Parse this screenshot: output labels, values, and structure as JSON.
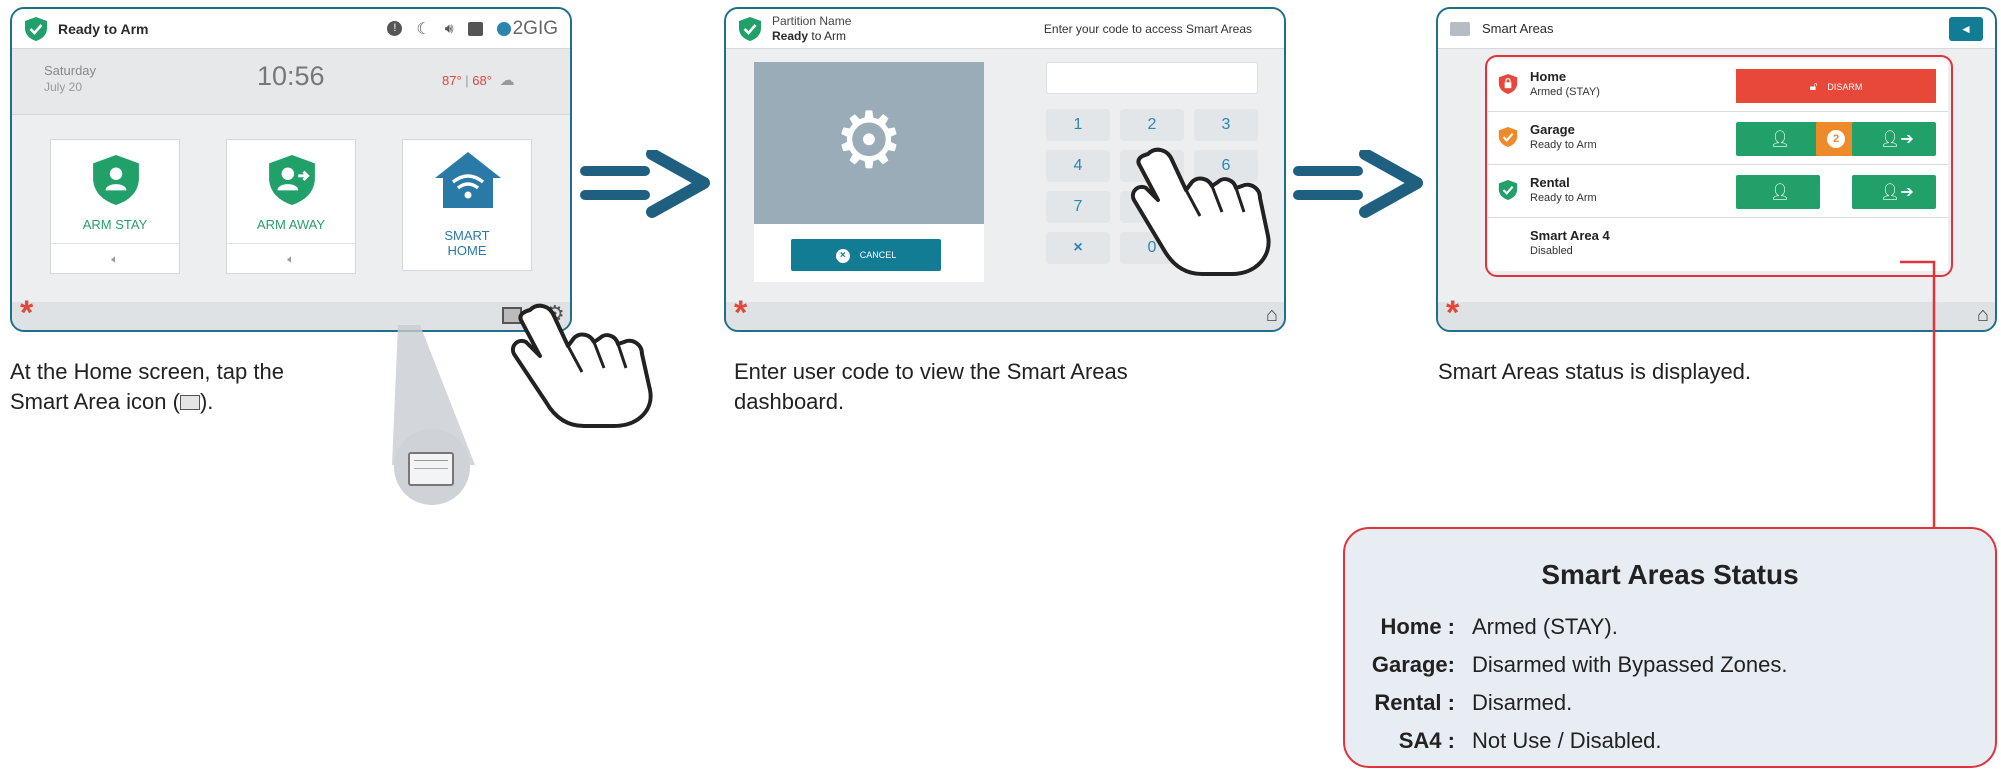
{
  "panel1": {
    "status": "Ready to Arm",
    "brand": "2GIG",
    "day": "Saturday",
    "date": "July 20",
    "time": "10:56",
    "temp_high": "87°",
    "temp_sep": " | ",
    "temp_low": "68°",
    "tiles": [
      {
        "label": "ARM STAY"
      },
      {
        "label": "ARM AWAY"
      },
      {
        "label_line1": "SMART",
        "label_line2": "HOME"
      }
    ]
  },
  "panel2": {
    "partition": "Partition Name",
    "status_bold": "Ready",
    "status_rest": " to Arm",
    "prompt": "Enter your code to access Smart Areas",
    "cancel_label": "CANCEL",
    "keys": [
      "1",
      "2",
      "3",
      "4",
      "5",
      "6",
      "7",
      "8",
      "×",
      "0"
    ]
  },
  "panel3": {
    "title": "Smart Areas",
    "areas": [
      {
        "name": "Home",
        "status": "Armed (STAY)",
        "action": "DISARM"
      },
      {
        "name": "Garage",
        "status": "Ready to Arm",
        "badge": "2"
      },
      {
        "name": "Rental",
        "status": "Ready to Arm"
      },
      {
        "name": "Smart Area 4",
        "status": "Disabled"
      }
    ]
  },
  "captions": {
    "c1_line1": "At the Home screen, tap the",
    "c1_line2a": "Smart Area icon (",
    "c1_line2b": ").",
    "c2_line1": "Enter user code to view the Smart Areas",
    "c2_line2": "dashboard.",
    "c3": "Smart Areas status is displayed."
  },
  "status_box": {
    "title": "Smart Areas Status",
    "rows": [
      {
        "key": "Home :",
        "value": "Armed (STAY)."
      },
      {
        "key": "Garage:",
        "value": "Disarmed with Bypassed Zones."
      },
      {
        "key": "Rental :",
        "value": "Disarmed."
      },
      {
        "key": "SA4 :",
        "value": "Not Use / Disabled."
      }
    ]
  },
  "colors": {
    "frame": "#1f6e8c",
    "green": "#21a06a",
    "red": "#e8483a",
    "orange": "#ee8a2a",
    "teal": "#117c94",
    "highlight": "#e0333c"
  }
}
